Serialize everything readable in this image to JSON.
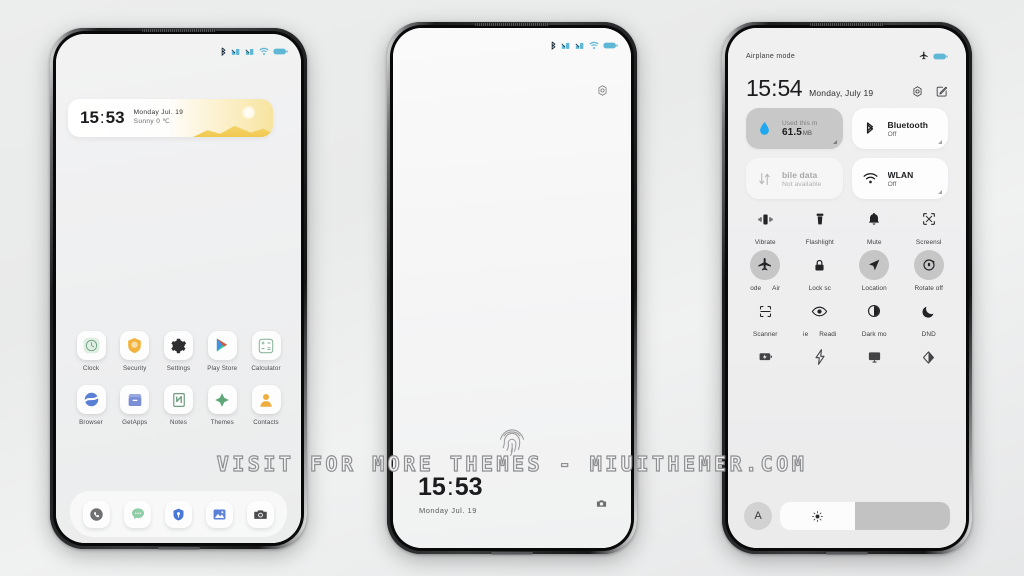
{
  "watermark": "VISIT FOR MORE THEMES - MIUITHEMER.COM",
  "phone1": {
    "label": "home-screen",
    "statusbar": {
      "icons": [
        "bluetooth-icon",
        "signal-1-icon",
        "signal-2-icon",
        "wifi-icon",
        "battery-icon"
      ]
    },
    "widget": {
      "time": "15",
      "colon": ":",
      "minutes": "53",
      "line1": "Monday  Jul. 19",
      "line2": "Sunny  0  ℃"
    },
    "apps_row1": [
      {
        "label": "Clock",
        "icon": "clock-icon"
      },
      {
        "label": "Security",
        "icon": "shield-icon"
      },
      {
        "label": "Settings",
        "icon": "gear-icon"
      },
      {
        "label": "Play Store",
        "icon": "play-store-icon"
      },
      {
        "label": "Calculator",
        "icon": "calculator-icon"
      }
    ],
    "apps_row2": [
      {
        "label": "Browser",
        "icon": "browser-icon"
      },
      {
        "label": "GetApps",
        "icon": "getapps-icon"
      },
      {
        "label": "Notes",
        "icon": "notes-icon"
      },
      {
        "label": "Themes",
        "icon": "themes-icon"
      },
      {
        "label": "Contacts",
        "icon": "contacts-icon"
      }
    ],
    "dock": [
      {
        "label": "Phone",
        "icon": "phone-icon"
      },
      {
        "label": "Messages",
        "icon": "messages-icon"
      },
      {
        "label": "Security",
        "icon": "security-dock-icon"
      },
      {
        "label": "Gallery",
        "icon": "gallery-icon"
      },
      {
        "label": "Camera",
        "icon": "camera-icon"
      }
    ]
  },
  "phone2": {
    "label": "lock-screen",
    "statusbar": {
      "icons": [
        "bluetooth-icon",
        "signal-1-icon",
        "signal-2-icon",
        "wifi-icon",
        "battery-icon"
      ]
    },
    "settings_icon": "gear-icon",
    "fingerprint_icon": "fingerprint-icon",
    "time": "15",
    "colon": ":",
    "minutes": "53",
    "date": "Monday  Jul. 19",
    "camera_icon": "camera-shortcut-icon"
  },
  "phone3": {
    "label": "control-center",
    "status_text": "Airplane mode",
    "status_icons": [
      "airplane-icon",
      "battery-icon"
    ],
    "time": "15",
    "colon": ":",
    "minutes": "54",
    "date": "Monday, July 19",
    "actions": [
      "settings-gear-icon",
      "edit-icon"
    ],
    "big_tiles": [
      {
        "title": "Used this m",
        "value": "61.5",
        "unit": "MB",
        "state": "active",
        "icon": "data-drop-icon"
      },
      {
        "title": "Bluetooth",
        "subtitle": "Off",
        "state": "normal",
        "icon": "bluetooth-icon"
      },
      {
        "title": "bile data",
        "subtitle": "Not available",
        "state": "dim",
        "icon": "mobile-data-icon"
      },
      {
        "title": "WLAN",
        "subtitle": "Off",
        "state": "normal",
        "icon": "wifi-icon"
      }
    ],
    "toggle_rows": [
      [
        {
          "label": "Vibrate",
          "icon": "vibrate-icon",
          "on": false
        },
        {
          "label": "Flashlight",
          "icon": "flashlight-icon",
          "on": false
        },
        {
          "label": "Mute",
          "icon": "bell-icon",
          "on": false
        },
        {
          "label": "Screensl",
          "icon": "screenshot-icon",
          "on": false
        }
      ],
      [
        {
          "label": "ode",
          "label2": "Air",
          "icon": "airplane-icon",
          "on": true
        },
        {
          "label": "Lock sc",
          "icon": "lock-icon",
          "on": false
        },
        {
          "label": "Location",
          "icon": "location-icon",
          "on": true
        },
        {
          "label": "Rotate off",
          "icon": "rotate-icon",
          "on": true
        }
      ],
      [
        {
          "label": "Scanner",
          "icon": "scanner-icon",
          "on": false
        },
        {
          "label": "ie",
          "label2": "Readi",
          "icon": "eye-icon",
          "on": false
        },
        {
          "label": "Dark mo",
          "icon": "dark-mode-icon",
          "on": false
        },
        {
          "label": "DND",
          "icon": "moon-icon",
          "on": false
        }
      ],
      [
        {
          "label": "",
          "icon": "battery-saver-icon",
          "on": false
        },
        {
          "label": "",
          "icon": "lightning-icon",
          "on": false
        },
        {
          "label": "",
          "icon": "cast-icon",
          "on": false
        },
        {
          "label": "",
          "icon": "contrast-icon",
          "on": false
        }
      ]
    ],
    "brightness": {
      "auto_label": "A",
      "icon": "brightness-icon",
      "fill_percent": 44
    }
  }
}
